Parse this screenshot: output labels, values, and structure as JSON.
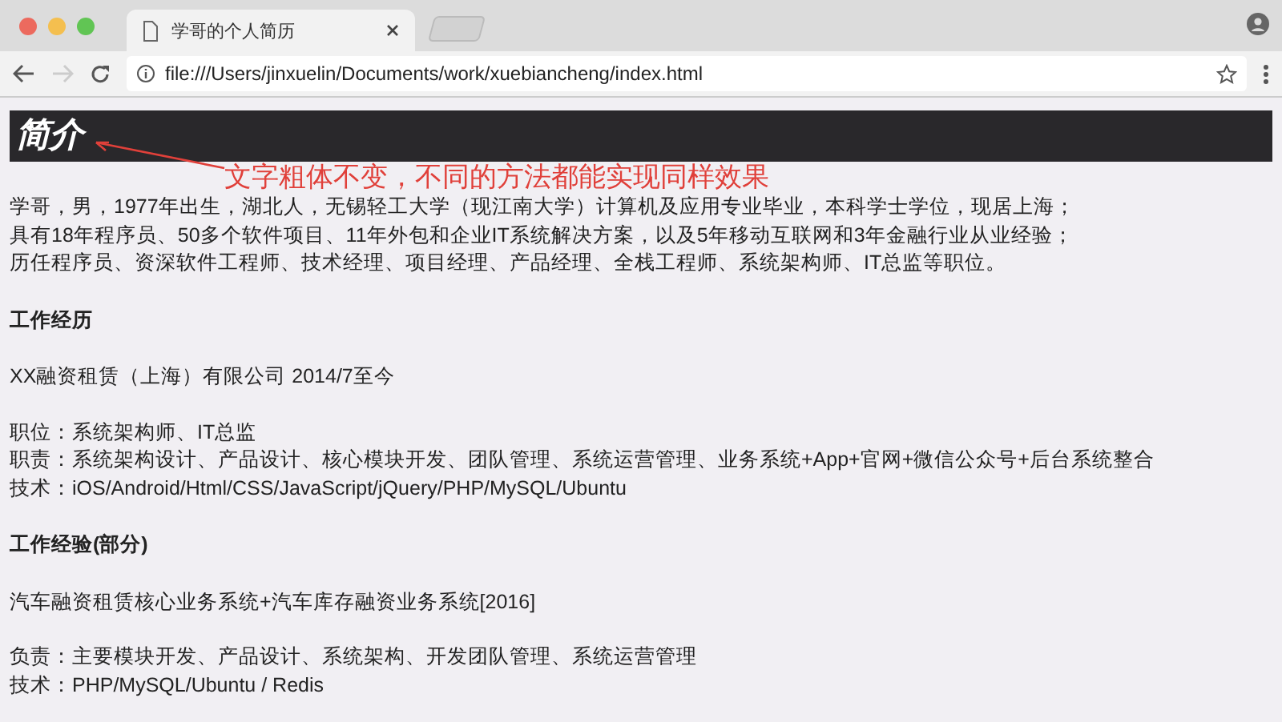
{
  "tab": {
    "title": "学哥的个人简历"
  },
  "address_bar": {
    "url": "file:///Users/jinxuelin/Documents/work/xuebiancheng/index.html"
  },
  "page": {
    "heading": "简介",
    "annotation": "文字粗体不变，不同的方法都能实现同样效果",
    "intro": [
      "学哥，男，1977年出生，湖北人，无锡轻工大学（现江南大学）计算机及应用专业毕业，本科学士学位，现居上海；",
      "具有18年程序员、50多个软件项目、11年外包和企业IT系统解决方案，以及5年移动互联网和3年金融行业从业经验；",
      "历任程序员、资深软件工程师、技术经理、项目经理、产品经理、全栈工程师、系统架构师、IT总监等职位。"
    ],
    "sections": [
      {
        "title": "工作经历",
        "groups": [
          [
            "XX融资租赁（上海）有限公司 2014/7至今"
          ],
          [
            "职位：系统架构师、IT总监",
            "职责：系统架构设计、产品设计、核心模块开发、团队管理、系统运营管理、业务系统+App+官网+微信公众号+后台系统整合",
            "技术：iOS/Android/Html/CSS/JavaScript/jQuery/PHP/MySQL/Ubuntu"
          ]
        ]
      },
      {
        "title": "工作经验(部分)",
        "groups": [
          [
            "汽车融资租赁核心业务系统+汽车库存融资业务系统[2016]"
          ],
          [
            "负责：主要模块开发、产品设计、系统架构、开发团队管理、系统运营管理",
            "技术：PHP/MySQL/Ubuntu / Redis"
          ]
        ]
      }
    ]
  }
}
